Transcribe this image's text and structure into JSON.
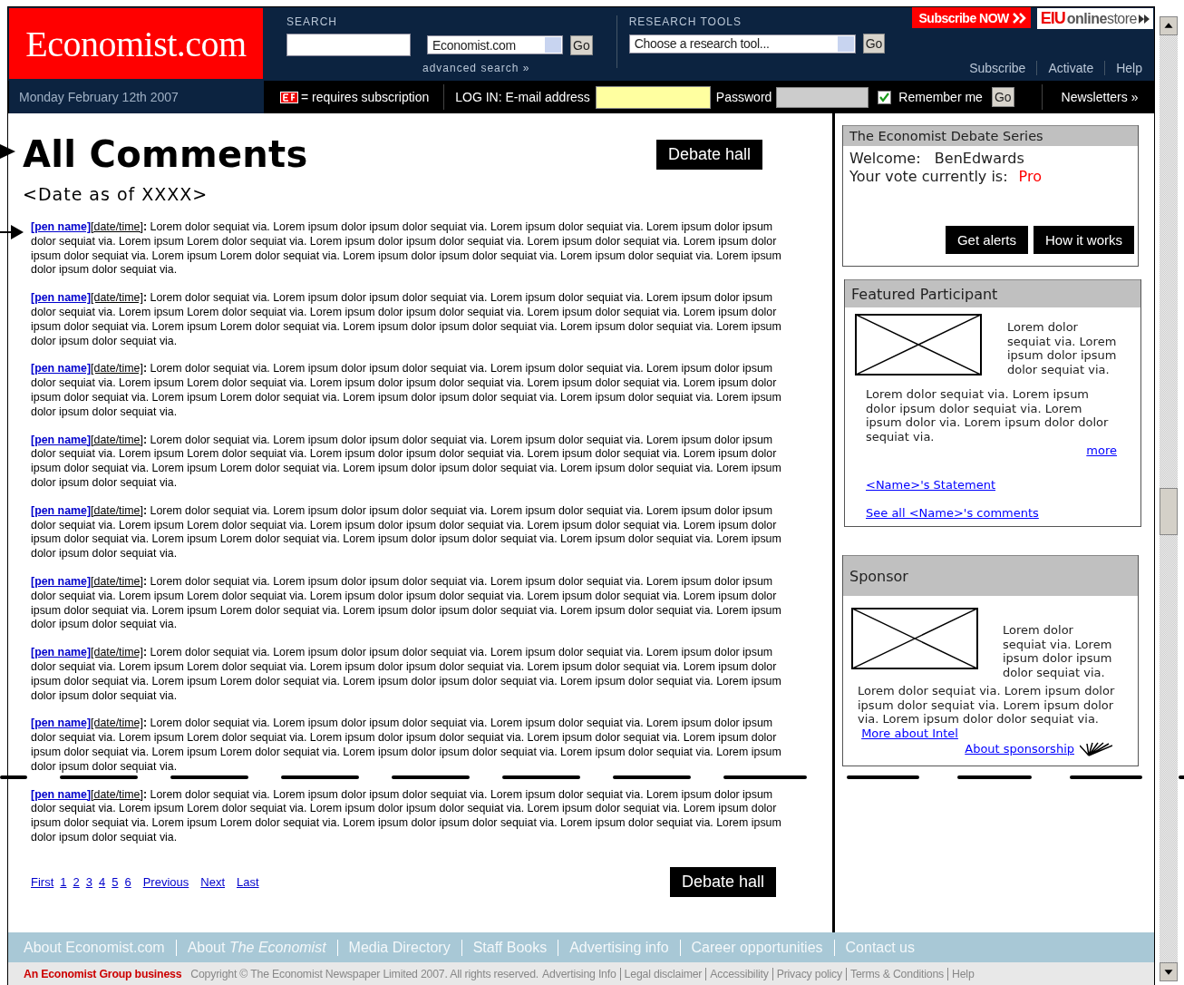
{
  "header": {
    "logo": "Economist.com",
    "search": {
      "label": "SEARCH",
      "scope": "Economist.com",
      "go": "Go",
      "advanced": "advanced search »"
    },
    "research_tools": {
      "label": "RESEARCH TOOLS",
      "select": "Choose a research tool...",
      "go": "Go"
    },
    "subscribe_now": "Subscribe NOW",
    "store": {
      "brand": "EIU",
      "name": "**online**store"
    },
    "links": [
      "Subscribe",
      "Activate",
      "Help"
    ],
    "date": "Monday February 12th 2007",
    "subscription_note": "= requires subscription",
    "login": {
      "label": "LOG IN: E-mail address",
      "password_label": "Password",
      "remember": {
        "label": "Remember me",
        "checked": true
      },
      "go": "Go"
    },
    "newsletters": "Newsletters »"
  },
  "main": {
    "title": "All Comments",
    "debate_hall": "Debate hall",
    "date_note": "<Date as of XXXX>",
    "comments": [
      {
        "pen_name": "[pen name]",
        "datetime": "[date/time]",
        "body": "**:** Lorem dolor sequiat via. Lorem ipsum dolor ipsum dolor sequiat via. Lorem ipsum dolor sequiat via. Lorem ipsum dolor ipsum dolor sequiat via. Lorem ipsum Lorem dolor sequiat via. Lorem ipsum dolor ipsum dolor sequiat via. Lorem ipsum dolor sequiat via. Lorem ipsum dolor ipsum dolor sequiat via. Lorem ipsum Lorem dolor sequiat via. Lorem ipsum dolor ipsum dolor sequiat via. Lorem ipsum dolor sequiat via. Lorem ipsum dolor ipsum dolor sequiat via."
      },
      {
        "pen_name": "[pen name]",
        "datetime": "[date/time]",
        "body": "**:** Lorem dolor sequiat via. Lorem ipsum dolor ipsum dolor sequiat via. Lorem ipsum dolor sequiat via. Lorem ipsum dolor ipsum dolor sequiat via. Lorem ipsum Lorem dolor sequiat via. Lorem ipsum dolor ipsum dolor sequiat via. Lorem ipsum dolor sequiat via. Lorem ipsum dolor ipsum dolor sequiat via. Lorem ipsum Lorem dolor sequiat via. Lorem ipsum dolor ipsum dolor sequiat via. Lorem ipsum dolor sequiat via. Lorem ipsum dolor ipsum dolor sequiat via."
      },
      {
        "pen_name": "[pen name]",
        "datetime": "[date/time]",
        "body": "**:** Lorem dolor sequiat via. Lorem ipsum dolor ipsum dolor sequiat via. Lorem ipsum dolor sequiat via. Lorem ipsum dolor ipsum dolor sequiat via. Lorem ipsum Lorem dolor sequiat via. Lorem ipsum dolor ipsum dolor sequiat via. Lorem ipsum dolor sequiat via. Lorem ipsum dolor ipsum dolor sequiat via. Lorem ipsum Lorem dolor sequiat via. Lorem ipsum dolor ipsum dolor sequiat via. Lorem ipsum dolor sequiat via. Lorem ipsum dolor ipsum dolor sequiat via."
      },
      {
        "pen_name": "[pen name]",
        "datetime": "[date/time]",
        "body": "**:** Lorem dolor sequiat via. Lorem ipsum dolor ipsum dolor sequiat via. Lorem ipsum dolor sequiat via. Lorem ipsum dolor ipsum dolor sequiat via. Lorem ipsum Lorem dolor sequiat via. Lorem ipsum dolor ipsum dolor sequiat via. Lorem ipsum dolor sequiat via. Lorem ipsum dolor ipsum dolor sequiat via. Lorem ipsum Lorem dolor sequiat via. Lorem ipsum dolor ipsum dolor sequiat via. Lorem ipsum dolor sequiat via. Lorem ipsum dolor ipsum dolor sequiat via."
      },
      {
        "pen_name": "[pen name]",
        "datetime": "[date/time]",
        "body": "**:** Lorem dolor sequiat via. Lorem ipsum dolor ipsum dolor sequiat via. Lorem ipsum dolor sequiat via. Lorem ipsum dolor ipsum dolor sequiat via. Lorem ipsum Lorem dolor sequiat via. Lorem ipsum dolor ipsum dolor sequiat via. Lorem ipsum dolor sequiat via. Lorem ipsum dolor ipsum dolor sequiat via. Lorem ipsum Lorem dolor sequiat via. Lorem ipsum dolor ipsum dolor sequiat via. Lorem ipsum dolor sequiat via. Lorem ipsum dolor ipsum dolor sequiat via."
      },
      {
        "pen_name": "[pen name]",
        "datetime": "[date/time]",
        "body": "**:** Lorem dolor sequiat via. Lorem ipsum dolor ipsum dolor sequiat via. Lorem ipsum dolor sequiat via. Lorem ipsum dolor ipsum dolor sequiat via. Lorem ipsum Lorem dolor sequiat via. Lorem ipsum dolor ipsum dolor sequiat via. Lorem ipsum dolor sequiat via. Lorem ipsum dolor ipsum dolor sequiat via. Lorem ipsum Lorem dolor sequiat via. Lorem ipsum dolor ipsum dolor sequiat via. Lorem ipsum dolor sequiat via. Lorem ipsum dolor ipsum dolor sequiat via."
      },
      {
        "pen_name": "[pen name]",
        "datetime": "[date/time]",
        "body": "**:** Lorem dolor sequiat via. Lorem ipsum dolor ipsum dolor sequiat via. Lorem ipsum dolor sequiat via. Lorem ipsum dolor ipsum dolor sequiat via. Lorem ipsum Lorem dolor sequiat via. Lorem ipsum dolor ipsum dolor sequiat via. Lorem ipsum dolor sequiat via. Lorem ipsum dolor ipsum dolor sequiat via. Lorem ipsum Lorem dolor sequiat via. Lorem ipsum dolor ipsum dolor sequiat via. Lorem ipsum dolor sequiat via. Lorem ipsum dolor ipsum dolor sequiat via."
      },
      {
        "pen_name": "[pen name]",
        "datetime": "[date/time]",
        "body": "**:** Lorem dolor sequiat via. Lorem ipsum dolor ipsum dolor sequiat via. Lorem ipsum dolor sequiat via. Lorem ipsum dolor ipsum dolor sequiat via. Lorem ipsum Lorem dolor sequiat via. Lorem ipsum dolor ipsum dolor sequiat via. Lorem ipsum dolor sequiat via. Lorem ipsum dolor ipsum dolor sequiat via. Lorem ipsum Lorem dolor sequiat via. Lorem ipsum dolor ipsum dolor sequiat via. Lorem ipsum dolor sequiat via. Lorem ipsum dolor ipsum dolor sequiat via."
      },
      {
        "pen_name": "[pen name]",
        "datetime": "[date/time]",
        "body": "**:** Lorem dolor sequiat via. Lorem ipsum dolor ipsum dolor sequiat via. Lorem ipsum dolor sequiat via. Lorem ipsum dolor ipsum dolor sequiat via. Lorem ipsum Lorem dolor sequiat via. Lorem ipsum dolor ipsum dolor sequiat via. Lorem ipsum dolor sequiat via. Lorem ipsum dolor ipsum dolor sequiat via. Lorem ipsum Lorem dolor sequiat via. Lorem ipsum dolor ipsum dolor sequiat via. Lorem ipsum dolor sequiat via. Lorem ipsum dolor ipsum dolor sequiat via."
      }
    ],
    "pagination": [
      "First",
      "1",
      "2",
      "3",
      "4",
      "5",
      "6",
      "Previous",
      "Next",
      "Last"
    ],
    "debate_hall_bottom": "Debate hall"
  },
  "sidebar": {
    "debate": {
      "title": "The Economist Debate Series",
      "welcome_label": "Welcome:",
      "user": "BenEdwards",
      "vote_label": "Your vote currently is:",
      "vote": "Pro",
      "buttons": [
        "Get alerts",
        "How it works"
      ]
    },
    "featured": {
      "title": "Featured Participant",
      "aside": "Lorem dolor sequiat via. Lorem ipsum dolor ipsum dolor sequiat via.",
      "text": "Lorem dolor sequiat via. Lorem ipsum dolor ipsum dolor sequiat via. Lorem ipsum dolor via. Lorem ipsum dolor dolor sequiat via.",
      "more": "more",
      "links": [
        "<Name>'s Statement",
        "See all <Name>'s comments"
      ]
    },
    "sponsor": {
      "title": "Sponsor",
      "aside": "Lorem dolor sequiat via. Lorem ipsum dolor ipsum dolor sequiat via.",
      "text": "Lorem dolor sequiat via. Lorem ipsum dolor ipsum dolor sequiat via. Lorem ipsum dolor via. Lorem ipsum dolor dolor sequiat via.",
      "more": "More about Intel",
      "about": "About sponsorship"
    }
  },
  "footer": {
    "links": [
      "About Economist.com",
      "About *The Economist*",
      "Media Directory",
      "Staff Books",
      "Advertising info",
      "Career opportunities",
      "Contact us"
    ],
    "group": "An Economist Group business",
    "copyright": "Copyright © The Economist Newspaper Limited 2007. All rights reserved.",
    "legal_links": [
      "Advertising Info",
      "Legal disclaimer",
      "Accessibility",
      "Privacy policy",
      "Terms & Conditions",
      "Help"
    ]
  }
}
